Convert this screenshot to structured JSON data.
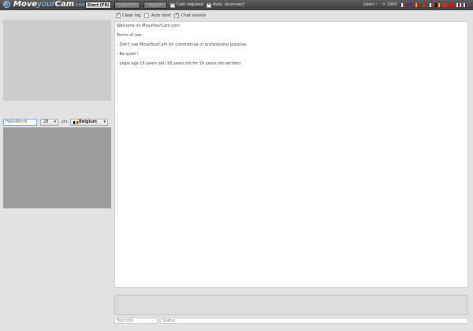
{
  "app": {
    "logo_part1": "Move",
    "logo_part2": "your",
    "logo_part3": "Cam",
    "logo_part4": ".com"
  },
  "toolbar": {
    "start_label": "Start (F9)",
    "stop_label": "Stop (F9)",
    "report_label": "Report",
    "cam_required_label": "Cam required",
    "auto_reconnect_label": "Auto. reconnect",
    "users_label": "Users :",
    "users_count": "> 1000"
  },
  "flags": [
    {
      "name": "france-flag",
      "colors": [
        "#1f3f9a",
        "#ffffff",
        "#d9232e"
      ]
    },
    {
      "name": "uk-flag",
      "colors": [
        "#2a3f8f",
        "#c8102e",
        "#2a3f8f"
      ]
    },
    {
      "name": "spain-flag",
      "colors": [
        "#c60b1e",
        "#ffc400",
        "#c60b1e"
      ]
    },
    {
      "name": "portugal-flag",
      "colors": [
        "#046a38",
        "#da291c",
        "#da291c"
      ]
    },
    {
      "name": "italy-flag",
      "colors": [
        "#009246",
        "#ffffff",
        "#ce2b37"
      ]
    },
    {
      "name": "germany-flag",
      "colors": [
        "#000000",
        "#dd0000",
        "#ffce00"
      ]
    },
    {
      "name": "china-flag",
      "colors": [
        "#de2910",
        "#de2910",
        "#de2910"
      ]
    },
    {
      "name": "turkey-flag",
      "colors": [
        "#e30a17",
        "#e30a17",
        "#e30a17"
      ]
    },
    {
      "name": "japan-flag",
      "colors": [
        "#ffffff",
        "#bc002d",
        "#ffffff"
      ]
    },
    {
      "name": "russia-flag",
      "colors": [
        "#ffffff",
        "#0039a6",
        "#d52b1e"
      ]
    }
  ],
  "options": {
    "clean_log_label": "Clean log",
    "auto_start_label": "Auto start",
    "chat_sounds_label": "Chat sounds"
  },
  "profile": {
    "name_value": "HelloWorld",
    "age_value": "28",
    "yo_label": "yrs",
    "country_value": "Belgium"
  },
  "chat": {
    "lines": [
      "Welcome on MoveYourCam.com",
      "",
      "Terms of use :",
      "",
      "- Don't use MoveYourCam for commercial or professional purpose.",
      "",
      "- Be quiet !",
      "",
      "- Legal age 16 years old (18 years old for 18 years old section)"
    ]
  },
  "bottom": {
    "city_placeholder": "Your city",
    "status_placeholder": "Status"
  }
}
